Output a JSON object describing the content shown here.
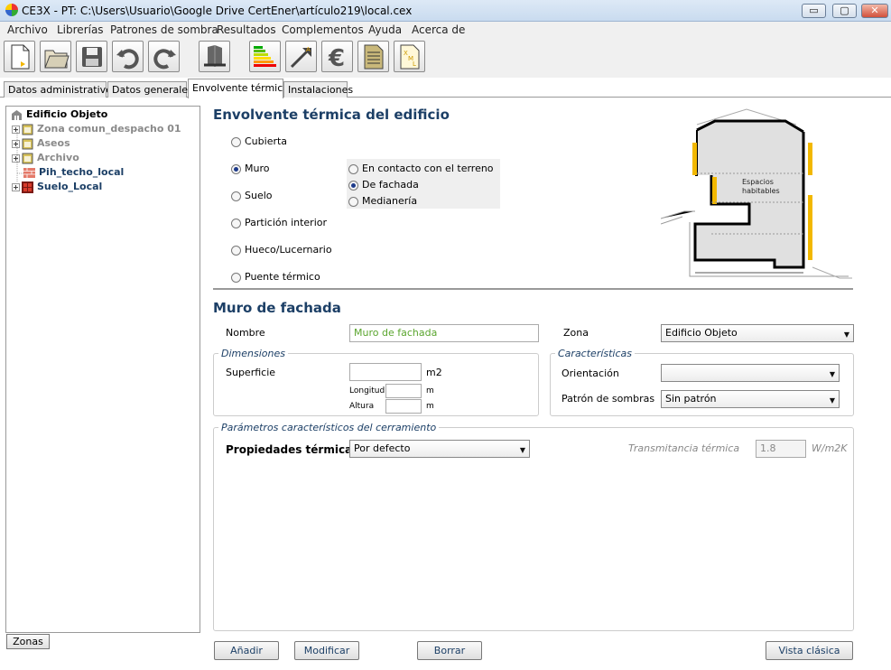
{
  "window": {
    "title": "CE3X - PT: C:\\Users\\Usuario\\Google Drive CertEner\\artículo219\\local.cex",
    "min": "▭",
    "max": "▢",
    "close": "✕"
  },
  "menu": [
    "Archivo",
    "Librerías",
    "Patrones de sombra",
    "Resultados",
    "Complementos",
    "Ayuda",
    "Acerca de"
  ],
  "tabs": [
    "Datos administrativos",
    "Datos generales",
    "Envolvente térmica",
    "Instalaciones"
  ],
  "tree": {
    "root": "Edificio Objeto",
    "children": [
      "Zona comun_despacho 01",
      "Aseos",
      "Archivo",
      "Pih_techo_local",
      "Suelo_Local"
    ]
  },
  "zonas_button": "Zonas",
  "envolvente": {
    "heading": "Envolvente térmica del edificio",
    "types": [
      "Cubierta",
      "Muro",
      "Suelo",
      "Partición interior",
      "Hueco/Lucernario",
      "Puente térmico"
    ],
    "selected": "Muro",
    "subtypes": [
      "En contacto con el terreno",
      "De fachada",
      "Medianería"
    ],
    "selected_sub": "De fachada"
  },
  "diagram": {
    "label": "Espacios\nhabitables"
  },
  "muro": {
    "heading": "Muro de fachada",
    "nombre_label": "Nombre",
    "nombre_value": "Muro de fachada",
    "zona_label": "Zona",
    "zona_value": "Edificio Objeto"
  },
  "dimensiones": {
    "title": "Dimensiones",
    "superficie": "Superficie",
    "unit_m2": "m2",
    "longitud": "Longitud",
    "altura": "Altura",
    "unit_m": "m"
  },
  "caracteristicas": {
    "title": "Características",
    "orientacion": "Orientación",
    "orientacion_value": "",
    "patron": "Patrón de sombras",
    "patron_value": "Sin patrón"
  },
  "parametros": {
    "title": "Parámetros característicos del cerramiento",
    "prop_label": "Propiedades térmicas",
    "prop_value": "Por defecto",
    "trans_label": "Transmitancia térmica",
    "trans_value": "1.8",
    "trans_unit": "W/m2K"
  },
  "buttons": {
    "add": "Añadir",
    "modify": "Modificar",
    "delete": "Borrar",
    "classic": "Vista clásica"
  }
}
